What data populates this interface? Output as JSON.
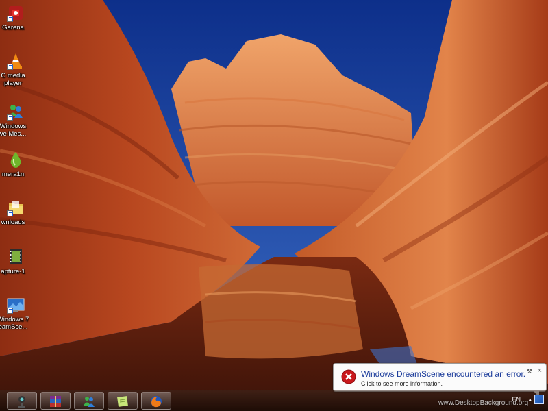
{
  "desktop_icons": [
    {
      "label": "Garena",
      "icon": "garena-icon"
    },
    {
      "label": "C media\nplayer",
      "icon": "vlc-cone-icon"
    },
    {
      "label": "Windows\nve Mes...",
      "icon": "messenger-icon"
    },
    {
      "label": "mera1n",
      "icon": "limera1n-drop-icon"
    },
    {
      "label": "wnloads",
      "icon": "folder-icon"
    },
    {
      "label": "apture-1",
      "icon": "video-file-icon"
    },
    {
      "label": "Windows 7\neamSce...",
      "icon": "dreamscene-icon"
    }
  ],
  "balloon": {
    "title": "Windows DreamScene encountered an error.",
    "message": "Click to see more information.",
    "icon": "error-x-icon"
  },
  "taskbar": {
    "buttons": [
      "webcam-icon",
      "winrar-icon",
      "messenger-icon",
      "sticky-notes-icon",
      "firefox-icon"
    ],
    "tray_language": "EN",
    "tray_arrow": "▴"
  },
  "watermark": "www.DesktopBackground.org",
  "colors": {
    "sky": "#1f4ea6",
    "rock": "#c8572b",
    "error_red": "#c8171b",
    "balloon_title": "#1e3e9c"
  }
}
